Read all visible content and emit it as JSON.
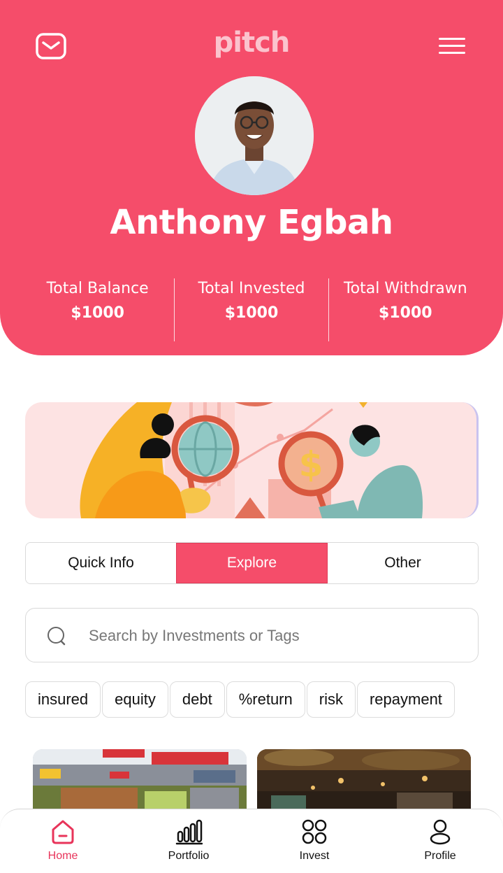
{
  "app": {
    "logo_text": "pitch"
  },
  "profile": {
    "name": "Anthony Egbah"
  },
  "stats": [
    {
      "label": "Total Balance",
      "value": "$1000"
    },
    {
      "label": "Total Invested",
      "value": "$1000"
    },
    {
      "label": "Total Withdrawn",
      "value": "$1000"
    }
  ],
  "tabs": [
    {
      "label": "Quick Info",
      "active": false
    },
    {
      "label": "Explore",
      "active": true
    },
    {
      "label": "Other",
      "active": false
    }
  ],
  "search": {
    "placeholder": "Search by Investments or Tags",
    "value": ""
  },
  "tags": [
    "insured",
    "equity",
    "debt",
    "%return",
    "risk",
    "repayment"
  ],
  "nav": [
    {
      "label": "Home",
      "icon": "home-icon",
      "active": true
    },
    {
      "label": "Portfolio",
      "icon": "bar-chart-icon",
      "active": false
    },
    {
      "label": "Invest",
      "icon": "grid-circles-icon",
      "active": false
    },
    {
      "label": "Profile",
      "icon": "user-icon",
      "active": false
    }
  ],
  "colors": {
    "brand": "#f54d6a",
    "brand_light": "#fbc3cd",
    "banner_bg": "#fde3e3",
    "active_nav": "#e8345a"
  }
}
